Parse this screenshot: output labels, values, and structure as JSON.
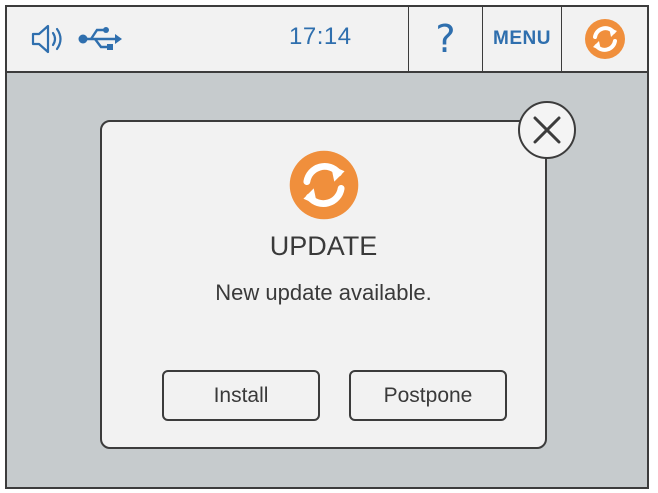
{
  "statusbar": {
    "time": "17:14",
    "help_label": "?",
    "menu_label": "MENU",
    "icons": [
      "speaker-icon",
      "usb-icon",
      "sync-icon"
    ],
    "accent_color": "#2f6fae",
    "sync_color": "#f08f3c"
  },
  "dialog": {
    "icon": "sync-icon",
    "title": "UPDATE",
    "message": "New update available.",
    "buttons": {
      "install": "Install",
      "postpone": "Postpone"
    },
    "close_icon": "close-icon"
  }
}
